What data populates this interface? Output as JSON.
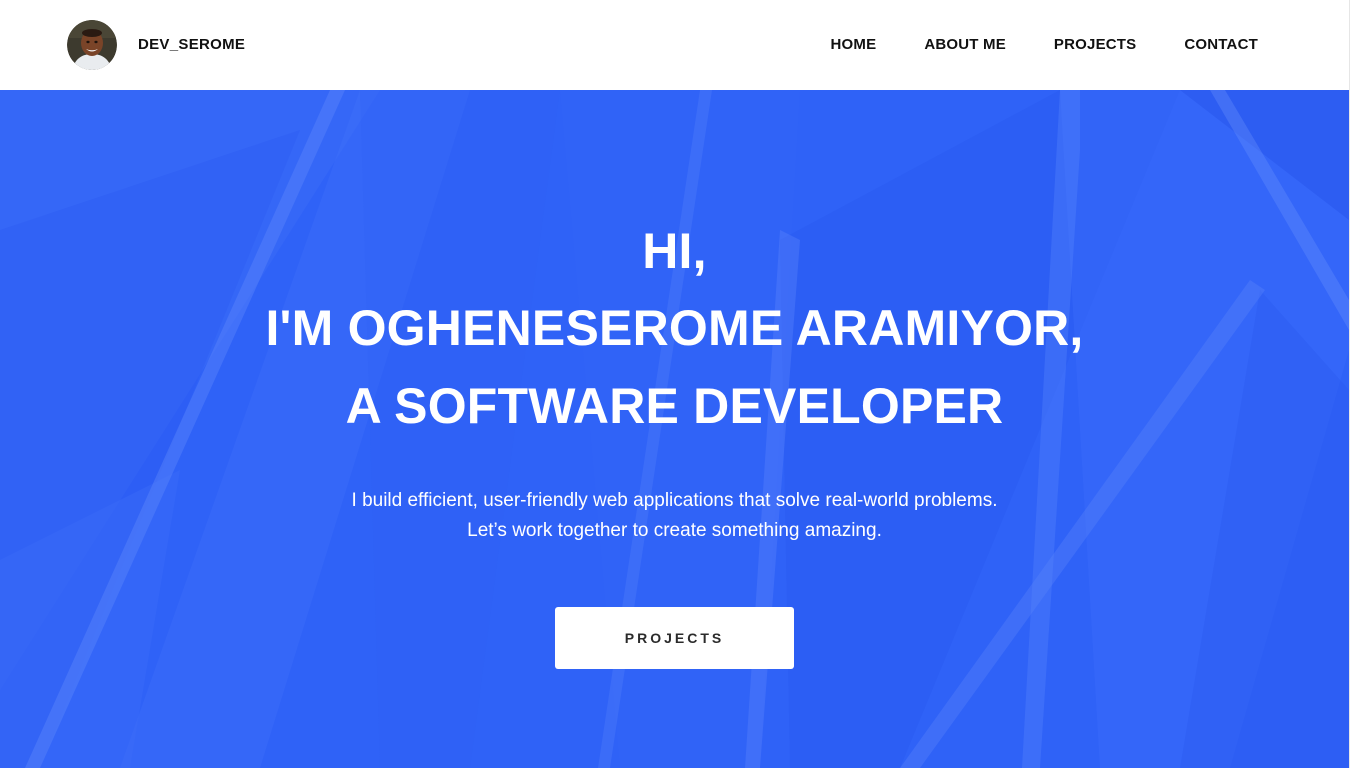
{
  "header": {
    "brand_name": "DEV_SEROME",
    "nav": [
      {
        "label": "HOME"
      },
      {
        "label": "ABOUT ME"
      },
      {
        "label": "PROJECTS"
      },
      {
        "label": "CONTACT"
      }
    ]
  },
  "hero": {
    "greeting": "HI,",
    "intro": "I'M OGHENESEROME ARAMIYOR,",
    "role": "A SOFTWARE DEVELOPER",
    "subtitle_line1": "I build efficient, user-friendly web applications that solve real-world problems.",
    "subtitle_line2": "Let’s work together to create something amazing.",
    "cta_label": "PROJECTS"
  },
  "colors": {
    "hero_background": "#2f62f7",
    "header_background": "#ffffff",
    "text_on_hero": "#ffffff",
    "nav_text": "#111111"
  }
}
